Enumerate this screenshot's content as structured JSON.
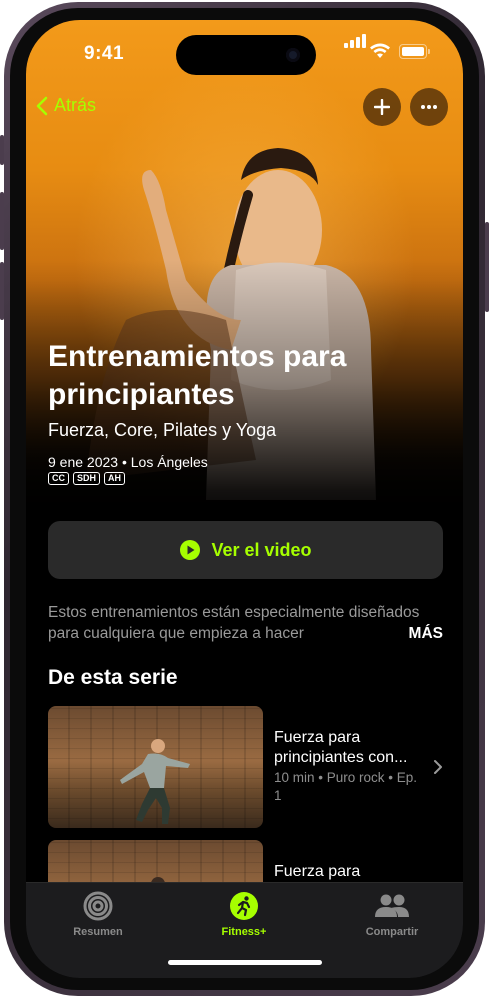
{
  "status_bar": {
    "time": "9:41"
  },
  "nav": {
    "back_label": "Atrás",
    "add_icon": "plus-icon",
    "more_icon": "ellipsis-icon"
  },
  "hero": {
    "title": "Entrenamientos para principiantes",
    "subtitle": "Fuerza, Core, Pilates y Yoga",
    "meta": "9 ene 2023 • Los Ángeles",
    "badges": [
      "CC",
      "SDH",
      "AH"
    ]
  },
  "play_button": {
    "label": "Ver el video",
    "icon": "play-circle-icon"
  },
  "description": {
    "text": "Estos entrenamientos están especialmente diseñados para cualquiera que empieza a hacer",
    "more_label": "MÁS"
  },
  "series": {
    "title": "De esta serie",
    "episodes": [
      {
        "title": "Fuerza para principiantes con...",
        "meta": "10 min • Puro rock • Ep. 1"
      },
      {
        "title": "Fuerza para",
        "meta": ""
      }
    ]
  },
  "tab_bar": {
    "items": [
      {
        "label": "Resumen",
        "icon": "activity-rings-icon"
      },
      {
        "label": "Fitness+",
        "icon": "running-figure-icon"
      },
      {
        "label": "Compartir",
        "icon": "people-icon"
      }
    ]
  },
  "colors": {
    "accent": "#a6ff00",
    "hero_orange": "#f39a1a",
    "background": "#000000"
  }
}
